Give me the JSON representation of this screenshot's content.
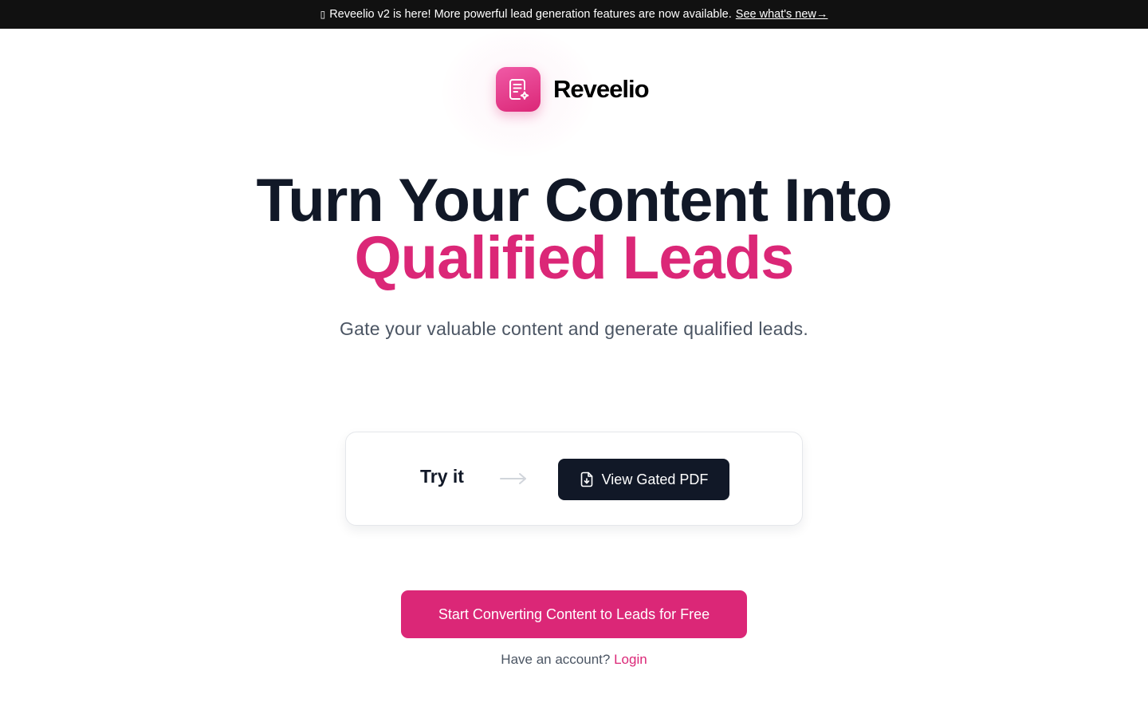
{
  "announcement": {
    "icon": "party-popper-icon",
    "text": "Reveelio v2 is here! More powerful lead generation features are now available.",
    "link_label": "See what's new",
    "link_arrow": "→"
  },
  "brand": {
    "name": "Reveelio",
    "logo_icon": "document-sparkle-icon"
  },
  "hero": {
    "title_line1": "Turn Your Content Into",
    "title_line2": "Qualified Leads",
    "subtitle": "Gate your valuable content and generate qualified leads."
  },
  "demo": {
    "try_label": "Try it",
    "arrow_icon": "arrow-right-icon",
    "button_label": "View Gated PDF",
    "button_icon": "file-download-icon"
  },
  "cta": {
    "label": "Start Converting Content to Leads for Free"
  },
  "account": {
    "prompt": "Have an account?",
    "login_label": "Login"
  },
  "colors": {
    "brand_pink": "#db2777",
    "dark": "#111827",
    "announcement_bg": "#111111",
    "muted_text": "#4b5563"
  }
}
